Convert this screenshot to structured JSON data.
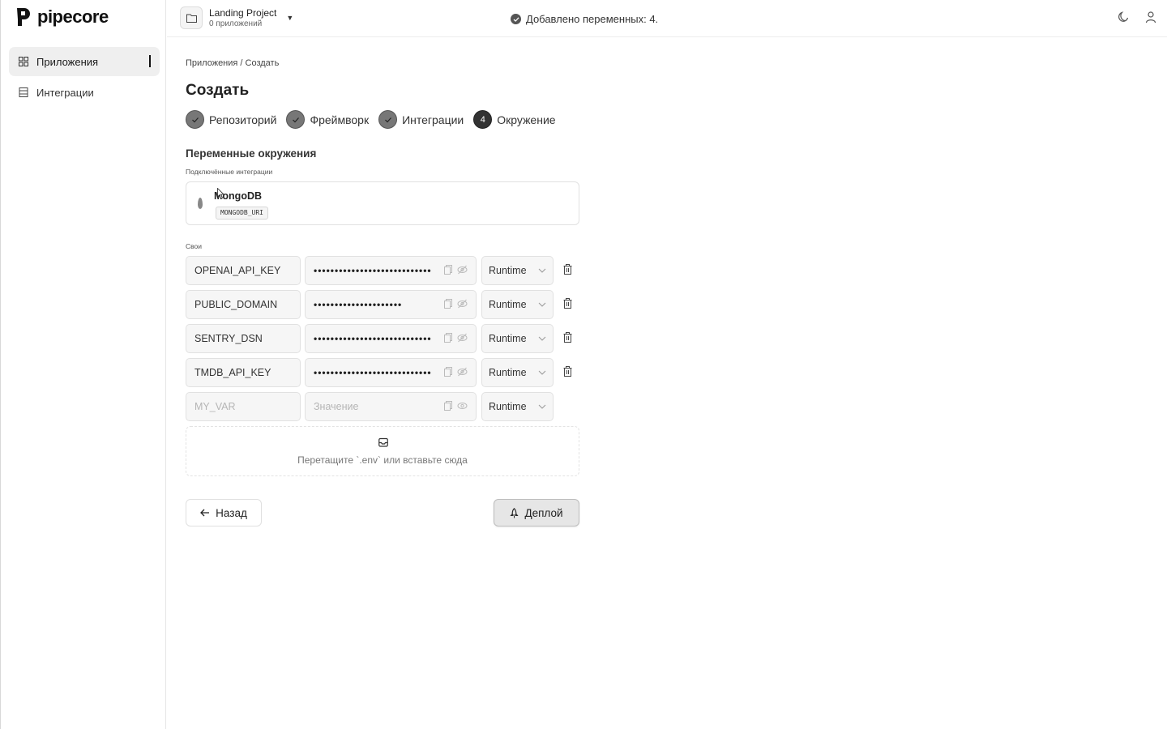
{
  "app": {
    "logo_text": "pipecore"
  },
  "sidebar": {
    "items": [
      {
        "label": "Приложения",
        "icon": "grid-icon",
        "active": true
      },
      {
        "label": "Интеграции",
        "icon": "list-icon",
        "active": false
      }
    ]
  },
  "topbar": {
    "project_name": "Landing Project",
    "project_sub": "0 приложений",
    "toast": "Добавлено переменных: 4.",
    "icons": [
      "moon-icon",
      "user-icon"
    ]
  },
  "main": {
    "breadcrumb": "Приложения / Создать",
    "title": "Создать",
    "steps": [
      {
        "label": "Репозиторий",
        "state": "done"
      },
      {
        "label": "Фреймворк",
        "state": "done"
      },
      {
        "label": "Интеграции",
        "state": "done"
      },
      {
        "label": "Окружение",
        "state": "current",
        "number": "4"
      }
    ],
    "section_title": "Переменные окружения",
    "connected_label": "Подключённые интеграции",
    "integration": {
      "name": "MongoDB",
      "var": "MONGODB_URI"
    },
    "custom_label": "Свои",
    "env_vars": [
      {
        "key": "OPENAI_API_KEY",
        "value": "••••••••••••••••••••••••••••",
        "scope": "Runtime"
      },
      {
        "key": "PUBLIC_DOMAIN",
        "value": "•••••••••••••••••••••",
        "scope": "Runtime"
      },
      {
        "key": "SENTRY_DSN",
        "value": "••••••••••••••••••••••••••••",
        "scope": "Runtime"
      },
      {
        "key": "TMDB_API_KEY",
        "value": "••••••••••••••••••••••••••••",
        "scope": "Runtime"
      }
    ],
    "new_var": {
      "key_placeholder": "MY_VAR",
      "value_placeholder": "Значение",
      "scope": "Runtime"
    },
    "dropzone_text": "Перетащите `.env` или вставьте сюда",
    "back_label": "Назад",
    "deploy_label": "Деплой"
  },
  "colors": {
    "accent": "#333333",
    "border": "#e1e1e1",
    "field_bg": "#f6f6f6"
  }
}
